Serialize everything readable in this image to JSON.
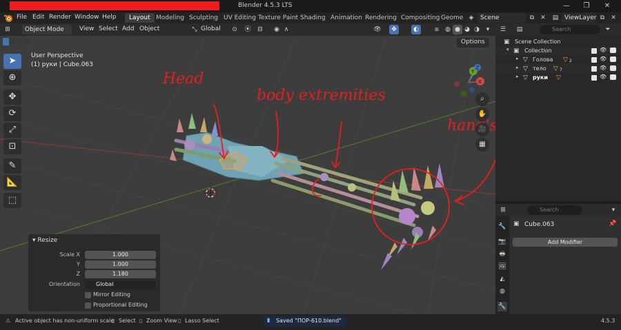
{
  "window": {
    "title": "Blender 4.5.3 LTS",
    "controls": {
      "minimize": "—",
      "maximize": "❐",
      "close": "✕"
    }
  },
  "menubar": {
    "items": [
      "File",
      "Edit",
      "Render",
      "Window",
      "Help"
    ],
    "workspaces": [
      "Layout",
      "Modeling",
      "Sculpting",
      "UV Editing",
      "Texture Paint",
      "Shading",
      "Animation",
      "Rendering",
      "Compositing",
      "Geome"
    ],
    "active_workspace": "Layout",
    "scene": "Scene",
    "view_layer": "ViewLayer"
  },
  "viewport_header": {
    "mode": "Object Mode",
    "menus": [
      "View",
      "Select",
      "Add",
      "Object"
    ],
    "transform_orientation": "Global",
    "options_label": "Options"
  },
  "viewport": {
    "perspective": "User Perspective",
    "active_info": "(1) руки | Cube.063",
    "annotations": [
      "Head",
      "body extremities",
      "hand's"
    ],
    "annotation_color": "#e81e1e",
    "gizmo_axes": {
      "x": "X",
      "y": "Y",
      "z": "Z"
    }
  },
  "resize_panel": {
    "title": "Resize",
    "scale_x_label": "Scale X",
    "scale_y_label": "Y",
    "scale_z_label": "Z",
    "scale_x": "1.000",
    "scale_y": "1.000",
    "scale_z": "1.180",
    "orientation_label": "Orientation",
    "orientation_value": "Global",
    "mirror_label": "Mirror Editing",
    "proportional_label": "Proportional Editing"
  },
  "outliner": {
    "search_placeholder": "Search",
    "scene_collection": "Scene Collection",
    "collection": "Collection",
    "items": [
      {
        "name": "Голова",
        "sub": "2"
      },
      {
        "name": "тело",
        "sub": "7"
      },
      {
        "name": "руки",
        "sub": ""
      }
    ]
  },
  "properties": {
    "search_placeholder": "Search",
    "object_name": "Cube.063",
    "add_modifier": "Add Modifier"
  },
  "statusbar": {
    "warning": "Active object has non-uniform scale",
    "select": "Select",
    "zoom_view": "Zoom View",
    "lasso_select": "Lasso Select",
    "saved": "Saved \"ПОР-610.blend\"",
    "version": "4.5.3"
  },
  "colors": {
    "accent": "#4772b3",
    "title_redaction": "#ee1c1c",
    "viewport_bg": "#3d3d3d"
  }
}
